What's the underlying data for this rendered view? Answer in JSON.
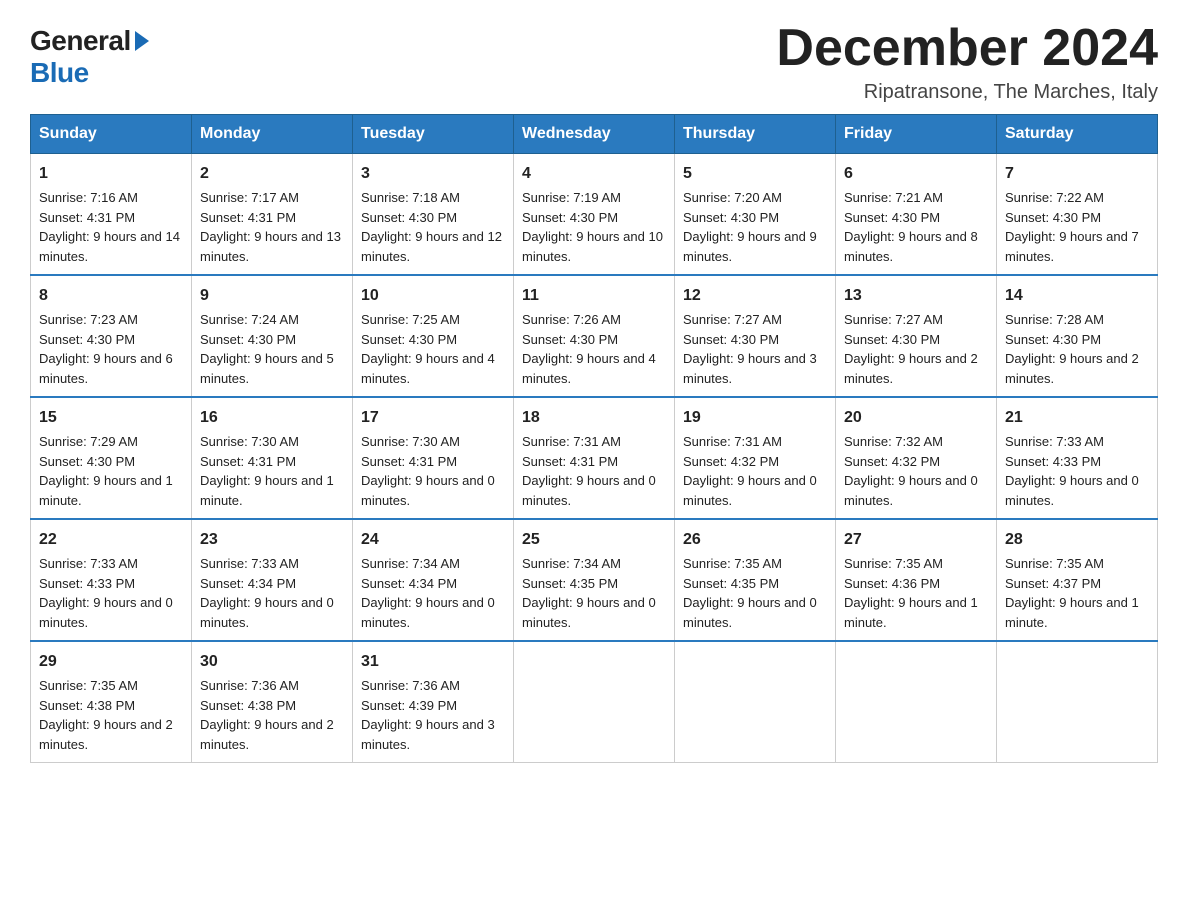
{
  "logo": {
    "general": "General",
    "blue": "Blue"
  },
  "header": {
    "month_year": "December 2024",
    "location": "Ripatransone, The Marches, Italy"
  },
  "weekdays": [
    "Sunday",
    "Monday",
    "Tuesday",
    "Wednesday",
    "Thursday",
    "Friday",
    "Saturday"
  ],
  "weeks": [
    [
      {
        "day": "1",
        "sunrise": "7:16 AM",
        "sunset": "4:31 PM",
        "daylight": "9 hours and 14 minutes."
      },
      {
        "day": "2",
        "sunrise": "7:17 AM",
        "sunset": "4:31 PM",
        "daylight": "9 hours and 13 minutes."
      },
      {
        "day": "3",
        "sunrise": "7:18 AM",
        "sunset": "4:30 PM",
        "daylight": "9 hours and 12 minutes."
      },
      {
        "day": "4",
        "sunrise": "7:19 AM",
        "sunset": "4:30 PM",
        "daylight": "9 hours and 10 minutes."
      },
      {
        "day": "5",
        "sunrise": "7:20 AM",
        "sunset": "4:30 PM",
        "daylight": "9 hours and 9 minutes."
      },
      {
        "day": "6",
        "sunrise": "7:21 AM",
        "sunset": "4:30 PM",
        "daylight": "9 hours and 8 minutes."
      },
      {
        "day": "7",
        "sunrise": "7:22 AM",
        "sunset": "4:30 PM",
        "daylight": "9 hours and 7 minutes."
      }
    ],
    [
      {
        "day": "8",
        "sunrise": "7:23 AM",
        "sunset": "4:30 PM",
        "daylight": "9 hours and 6 minutes."
      },
      {
        "day": "9",
        "sunrise": "7:24 AM",
        "sunset": "4:30 PM",
        "daylight": "9 hours and 5 minutes."
      },
      {
        "day": "10",
        "sunrise": "7:25 AM",
        "sunset": "4:30 PM",
        "daylight": "9 hours and 4 minutes."
      },
      {
        "day": "11",
        "sunrise": "7:26 AM",
        "sunset": "4:30 PM",
        "daylight": "9 hours and 4 minutes."
      },
      {
        "day": "12",
        "sunrise": "7:27 AM",
        "sunset": "4:30 PM",
        "daylight": "9 hours and 3 minutes."
      },
      {
        "day": "13",
        "sunrise": "7:27 AM",
        "sunset": "4:30 PM",
        "daylight": "9 hours and 2 minutes."
      },
      {
        "day": "14",
        "sunrise": "7:28 AM",
        "sunset": "4:30 PM",
        "daylight": "9 hours and 2 minutes."
      }
    ],
    [
      {
        "day": "15",
        "sunrise": "7:29 AM",
        "sunset": "4:30 PM",
        "daylight": "9 hours and 1 minute."
      },
      {
        "day": "16",
        "sunrise": "7:30 AM",
        "sunset": "4:31 PM",
        "daylight": "9 hours and 1 minute."
      },
      {
        "day": "17",
        "sunrise": "7:30 AM",
        "sunset": "4:31 PM",
        "daylight": "9 hours and 0 minutes."
      },
      {
        "day": "18",
        "sunrise": "7:31 AM",
        "sunset": "4:31 PM",
        "daylight": "9 hours and 0 minutes."
      },
      {
        "day": "19",
        "sunrise": "7:31 AM",
        "sunset": "4:32 PM",
        "daylight": "9 hours and 0 minutes."
      },
      {
        "day": "20",
        "sunrise": "7:32 AM",
        "sunset": "4:32 PM",
        "daylight": "9 hours and 0 minutes."
      },
      {
        "day": "21",
        "sunrise": "7:33 AM",
        "sunset": "4:33 PM",
        "daylight": "9 hours and 0 minutes."
      }
    ],
    [
      {
        "day": "22",
        "sunrise": "7:33 AM",
        "sunset": "4:33 PM",
        "daylight": "9 hours and 0 minutes."
      },
      {
        "day": "23",
        "sunrise": "7:33 AM",
        "sunset": "4:34 PM",
        "daylight": "9 hours and 0 minutes."
      },
      {
        "day": "24",
        "sunrise": "7:34 AM",
        "sunset": "4:34 PM",
        "daylight": "9 hours and 0 minutes."
      },
      {
        "day": "25",
        "sunrise": "7:34 AM",
        "sunset": "4:35 PM",
        "daylight": "9 hours and 0 minutes."
      },
      {
        "day": "26",
        "sunrise": "7:35 AM",
        "sunset": "4:35 PM",
        "daylight": "9 hours and 0 minutes."
      },
      {
        "day": "27",
        "sunrise": "7:35 AM",
        "sunset": "4:36 PM",
        "daylight": "9 hours and 1 minute."
      },
      {
        "day": "28",
        "sunrise": "7:35 AM",
        "sunset": "4:37 PM",
        "daylight": "9 hours and 1 minute."
      }
    ],
    [
      {
        "day": "29",
        "sunrise": "7:35 AM",
        "sunset": "4:38 PM",
        "daylight": "9 hours and 2 minutes."
      },
      {
        "day": "30",
        "sunrise": "7:36 AM",
        "sunset": "4:38 PM",
        "daylight": "9 hours and 2 minutes."
      },
      {
        "day": "31",
        "sunrise": "7:36 AM",
        "sunset": "4:39 PM",
        "daylight": "9 hours and 3 minutes."
      },
      null,
      null,
      null,
      null
    ]
  ]
}
